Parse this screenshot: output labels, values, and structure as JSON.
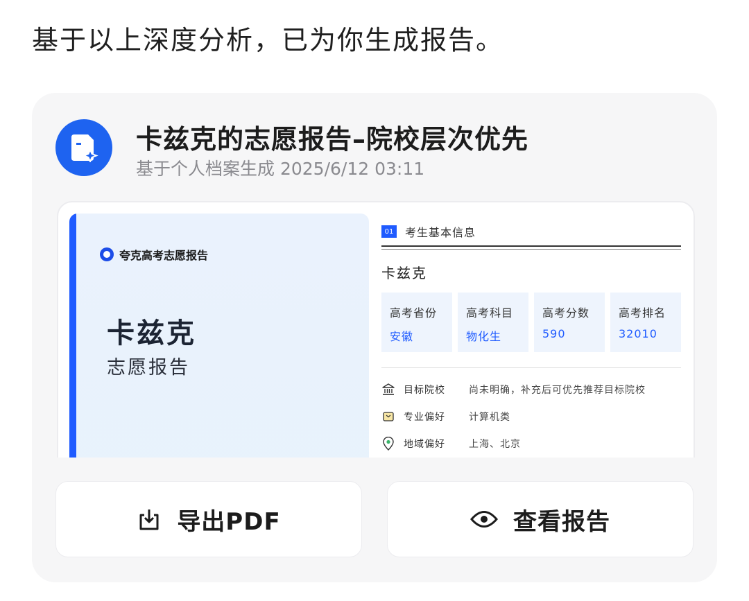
{
  "intro_text": "基于以上深度分析，已为你生成报告。",
  "report_card": {
    "title": "卡兹克的志愿报告–院校层次优先",
    "subtitle": "基于个人档案生成 2025/6/12 03:11",
    "accent_color": "#1e63f0"
  },
  "preview": {
    "cover": {
      "brand": "夸克高考志愿报告",
      "name": "卡兹克",
      "subtitle": "志愿报告"
    },
    "section": {
      "number": "01",
      "title": "考生基本信息"
    },
    "student_name": "卡兹克",
    "stats": [
      {
        "label": "高考省份",
        "value": "安徽"
      },
      {
        "label": "高考科目",
        "value": "物化生"
      },
      {
        "label": "高考分数",
        "value": "590"
      },
      {
        "label": "高考排名",
        "value": "32010"
      }
    ],
    "preferences": [
      {
        "icon": "institution-icon",
        "label": "目标院校",
        "value": "尚未明确，补充后可优先推荐目标院校"
      },
      {
        "icon": "major-icon",
        "label": "专业偏好",
        "value": "计算机类"
      },
      {
        "icon": "location-pin-icon",
        "label": "地域偏好",
        "value": "上海、北京"
      }
    ]
  },
  "actions": {
    "export_label": "导出PDF",
    "export_icon": "export-icon",
    "view_label": "查看报告",
    "view_icon": "eye-icon"
  }
}
